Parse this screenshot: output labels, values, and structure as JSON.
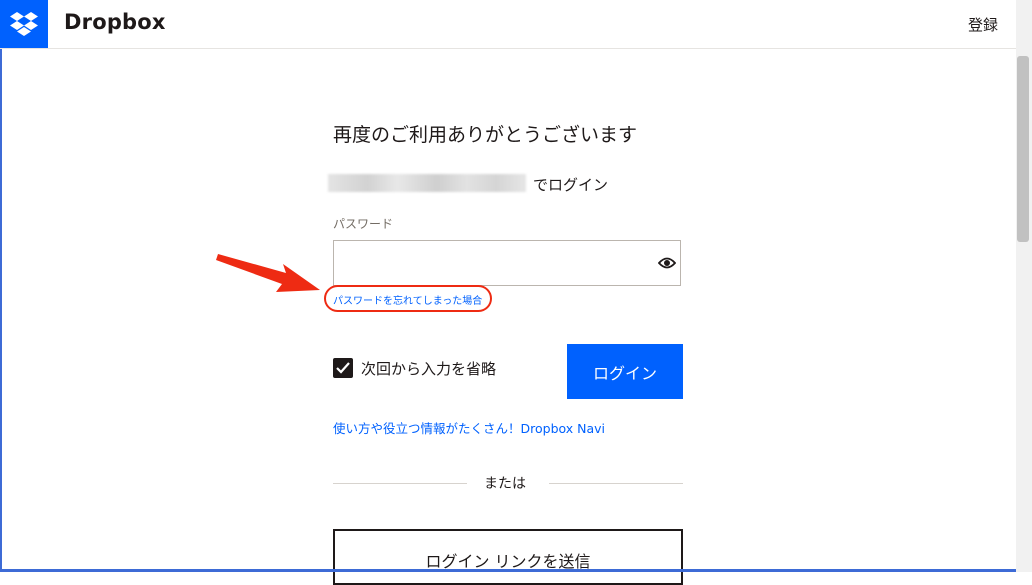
{
  "header": {
    "brand": "Dropbox",
    "signup_label": "登録"
  },
  "main": {
    "title": "再度のご利用ありがとうございます",
    "login_suffix": "でログイン",
    "password_label": "パスワード",
    "password_value": "",
    "forgot_password": "パスワードを忘れてしまった場合",
    "remember_label": "次回から入力を省略",
    "remember_checked": true,
    "login_button": "ログイン",
    "navi_link": "使い方や役立つ情報がたくさん！Dropbox Navi",
    "or_text": "または",
    "send_link_button": "ログイン リンクを送信"
  },
  "colors": {
    "brand_blue": "#0061fe",
    "annotation_red": "#ee2b13",
    "text": "#1e1919"
  },
  "icons": {
    "logo": "dropbox-logo-icon",
    "password_toggle": "eye-icon",
    "checkbox": "checkmark-icon",
    "annotation": "red-arrow-icon"
  }
}
